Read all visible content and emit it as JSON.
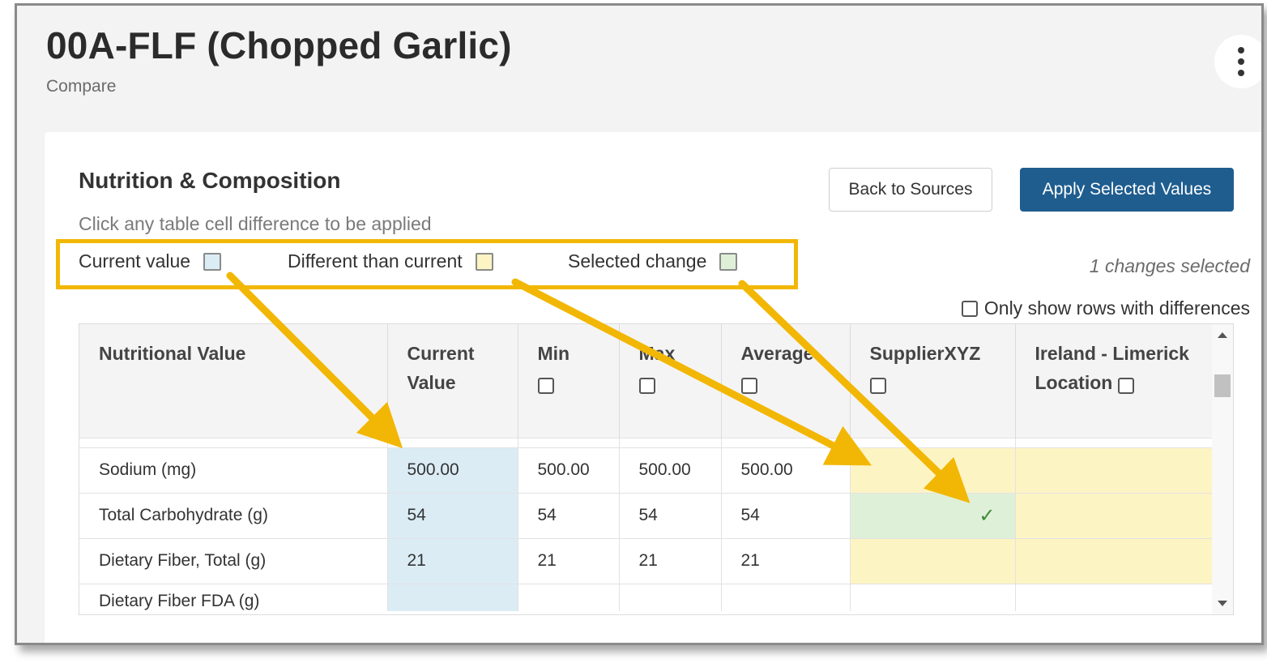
{
  "header": {
    "title": "00A-FLF (Chopped Garlic)",
    "subtitle": "Compare",
    "more_icon": "vertical-ellipsis-icon"
  },
  "section": {
    "title": "Nutrition & Composition",
    "hint": "Click any table cell difference to be applied"
  },
  "buttons": {
    "back": "Back to Sources",
    "apply": "Apply Selected Values"
  },
  "legend": {
    "current": "Current value",
    "different": "Different than current",
    "selected": "Selected change",
    "colors": {
      "current": "#dbecf5",
      "different": "#fdf4c4",
      "selected": "#dff0d8",
      "highlight": "#f2b705"
    }
  },
  "status": {
    "changes": "1 changes selected",
    "only_diff": "Only show rows with differences"
  },
  "table": {
    "columns": [
      "Nutritional Value",
      "Current Value",
      "Min",
      "Max",
      "Average",
      "SupplierXYZ",
      "Ireland - Limerick Location"
    ],
    "rows": [
      {
        "name": "Sodium (mg)",
        "current": "500.00",
        "min": "500.00",
        "max": "500.00",
        "avg": "500.00",
        "supplier": "",
        "ireland": ""
      },
      {
        "name": "Total Carbohydrate (g)",
        "current": "54",
        "min": "54",
        "max": "54",
        "avg": "54",
        "supplier": "✓",
        "ireland": ""
      },
      {
        "name": "Dietary Fiber, Total (g)",
        "current": "21",
        "min": "21",
        "max": "21",
        "avg": "21",
        "supplier": "",
        "ireland": ""
      },
      {
        "name": "Dietary Fiber FDA (g)",
        "current": "",
        "min": "",
        "max": "",
        "avg": "",
        "supplier": "",
        "ireland": ""
      }
    ]
  }
}
